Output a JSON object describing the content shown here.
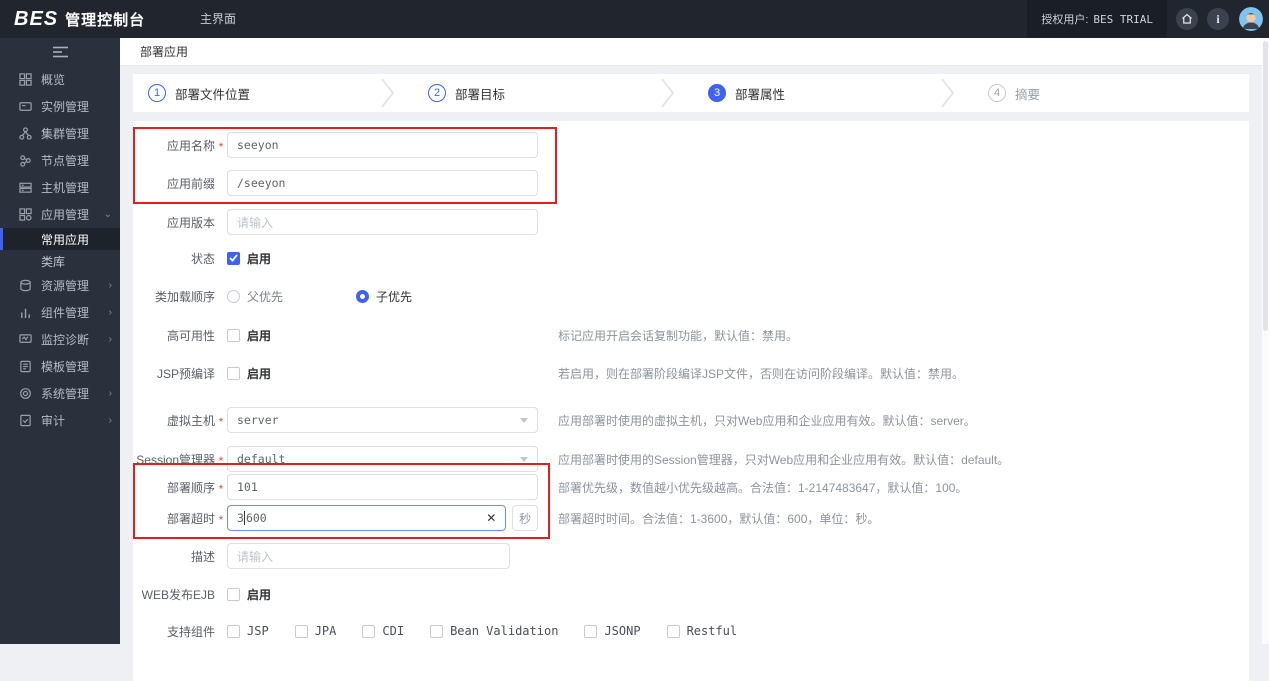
{
  "header": {
    "logo_text": "BES",
    "logo_suffix": "管理控制台",
    "tab": "主界面",
    "licensed_user_label": "授权用户:",
    "licensed_user_value": "BES TRIAL"
  },
  "sidebar": {
    "items": [
      {
        "label": "概览"
      },
      {
        "label": "实例管理"
      },
      {
        "label": "集群管理"
      },
      {
        "label": "节点管理"
      },
      {
        "label": "主机管理"
      },
      {
        "label": "应用管理"
      },
      {
        "label": "常用应用"
      },
      {
        "label": "类库"
      },
      {
        "label": "资源管理"
      },
      {
        "label": "组件管理"
      },
      {
        "label": "监控诊断"
      },
      {
        "label": "模板管理"
      },
      {
        "label": "系统管理"
      },
      {
        "label": "审计"
      }
    ]
  },
  "page": {
    "title": "部署应用"
  },
  "wizard": {
    "steps": [
      {
        "num": "1",
        "label": "部署文件位置",
        "state": "done"
      },
      {
        "num": "2",
        "label": "部署目标",
        "state": "done"
      },
      {
        "num": "3",
        "label": "部署属性",
        "state": "current"
      },
      {
        "num": "4",
        "label": "摘要",
        "state": "pending"
      }
    ]
  },
  "form": {
    "required_mark": "*",
    "fields": {
      "app_name": {
        "label": "应用名称",
        "required": true,
        "value": "seeyon"
      },
      "app_prefix": {
        "label": "应用前缀",
        "value": "/seeyon"
      },
      "app_version": {
        "label": "应用版本",
        "placeholder": "请输入"
      },
      "status": {
        "label": "状态",
        "checkbox_label": "启用",
        "checked": true
      },
      "class_load_order": {
        "label": "类加载顺序",
        "options": [
          "父优先",
          "子优先"
        ],
        "selected": "子优先"
      },
      "high_availability": {
        "label": "高可用性",
        "checkbox_label": "启用",
        "checked": false,
        "hint": "标记应用开启会话复制功能，默认值：禁用。"
      },
      "jsp_precompile": {
        "label": "JSP预编译",
        "checkbox_label": "启用",
        "checked": false,
        "hint": "若启用，则在部署阶段编译JSP文件，否则在访问阶段编译。默认值：禁用。"
      },
      "virtual_host": {
        "label": "虚拟主机",
        "required": true,
        "value": "server",
        "hint": "应用部署时使用的虚拟主机，只对Web应用和企业应用有效。默认值：server。"
      },
      "session_manager": {
        "label": "Session管理器",
        "required": true,
        "value": "default",
        "hint": "应用部署时使用的Session管理器，只对Web应用和企业应用有效。默认值：default。"
      },
      "deploy_order": {
        "label": "部署顺序",
        "required": true,
        "value": "101",
        "hint": "部署优先级，数值越小优先级越高。合法值：1-2147483647，默认值：100。"
      },
      "deploy_timeout": {
        "label": "部署超时",
        "required": true,
        "value_before_caret": "3",
        "value_after_caret": "600",
        "unit": "秒",
        "hint": "部署超时时间。合法值：1-3600，默认值：600，单位：秒。"
      },
      "description": {
        "label": "描述",
        "placeholder": "请输入"
      },
      "web_publish_ejb": {
        "label": "WEB发布EJB",
        "checkbox_label": "启用",
        "checked": false
      },
      "supported_components": {
        "label": "支持组件",
        "options": [
          "JSP",
          "JPA",
          "CDI",
          "Bean Validation",
          "JSONP",
          "Restful"
        ]
      }
    }
  },
  "colors": {
    "accent": "#3f62f0",
    "annotation": "#e02020",
    "header_bg": "#21252e",
    "sidebar_bg": "#2b313c"
  }
}
